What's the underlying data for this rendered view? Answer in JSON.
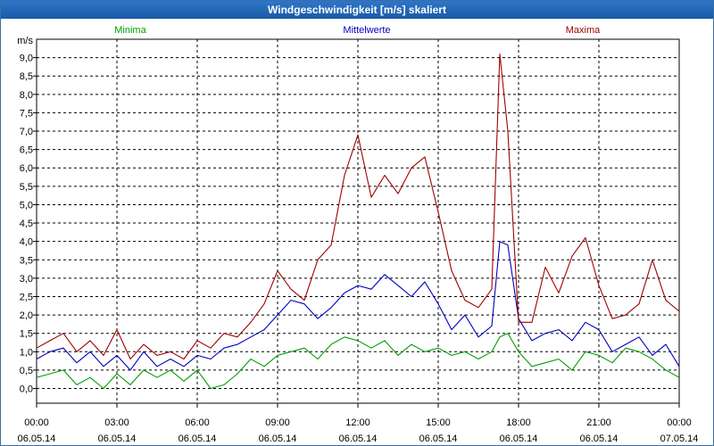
{
  "window": {
    "title": "Windgeschwindigkeit [m/s] skaliert"
  },
  "colors": {
    "minima": "#00a000",
    "mittelwerte": "#0000c0",
    "maxima": "#a00000"
  },
  "chart_data": {
    "type": "line",
    "title": "Windgeschwindigkeit [m/s] skaliert",
    "ylabel": "m/s",
    "xlabel": "",
    "ylim": [
      -0.4,
      9.5
    ],
    "xlim": [
      0,
      24
    ],
    "y_ticks": [
      "0,0",
      "0,5",
      "1,0",
      "1,5",
      "2,0",
      "2,5",
      "3,0",
      "3,5",
      "4,0",
      "4,5",
      "5,0",
      "5,5",
      "6,0",
      "6,5",
      "7,0",
      "7,5",
      "8,0",
      "8,5",
      "9,0"
    ],
    "x_ticks": [
      {
        "time": "00:00",
        "date": "06.05.14"
      },
      {
        "time": "03:00",
        "date": "06.05.14"
      },
      {
        "time": "06:00",
        "date": "06.05.14"
      },
      {
        "time": "09:00",
        "date": "06.05.14"
      },
      {
        "time": "12:00",
        "date": "06.05.14"
      },
      {
        "time": "15:00",
        "date": "06.05.14"
      },
      {
        "time": "18:00",
        "date": "06.05.14"
      },
      {
        "time": "21:00",
        "date": "06.05.14"
      },
      {
        "time": "00:00",
        "date": "07.05.14"
      }
    ],
    "grid": true,
    "legend_placement": "top",
    "series": [
      {
        "name": "Minima",
        "color": "#00a000",
        "x": [
          0,
          0.5,
          1,
          1.5,
          2,
          2.5,
          3,
          3.5,
          4,
          4.5,
          5,
          5.5,
          6,
          6.5,
          7,
          7.5,
          8,
          8.5,
          9,
          9.5,
          10,
          10.5,
          11,
          11.5,
          12,
          12.5,
          13,
          13.5,
          14,
          14.5,
          15,
          15.5,
          16,
          16.5,
          17,
          17.3,
          17.6,
          18,
          18.5,
          19,
          19.5,
          20,
          20.5,
          21,
          21.5,
          22,
          22.5,
          23,
          23.5,
          24
        ],
        "y": [
          0.3,
          0.4,
          0.5,
          0.1,
          0.3,
          0,
          0.4,
          0.1,
          0.5,
          0.3,
          0.5,
          0.2,
          0.5,
          0,
          0.1,
          0.4,
          0.8,
          0.6,
          0.9,
          1,
          1.1,
          0.8,
          1.2,
          1.4,
          1.3,
          1.1,
          1.3,
          0.9,
          1.2,
          1,
          1.1,
          0.9,
          1,
          0.8,
          1,
          1.4,
          1.5,
          1,
          0.6,
          0.7,
          0.8,
          0.5,
          1,
          0.9,
          0.7,
          1.1,
          1,
          0.8,
          0.5,
          0.3
        ]
      },
      {
        "name": "Mittelwerte",
        "color": "#0000c0",
        "x": [
          0,
          0.5,
          1,
          1.5,
          2,
          2.5,
          3,
          3.5,
          4,
          4.5,
          5,
          5.5,
          6,
          6.5,
          7,
          7.5,
          8,
          8.5,
          9,
          9.5,
          10,
          10.5,
          11,
          11.5,
          12,
          12.5,
          13,
          13.5,
          14,
          14.5,
          15,
          15.5,
          16,
          16.5,
          17,
          17.3,
          17.6,
          18,
          18.5,
          19,
          19.5,
          20,
          20.5,
          21,
          21.5,
          22,
          22.5,
          23,
          23.5,
          24
        ],
        "y": [
          0.8,
          1,
          1.1,
          0.7,
          1,
          0.6,
          0.9,
          0.5,
          1,
          0.6,
          0.8,
          0.6,
          0.9,
          0.8,
          1.1,
          1.2,
          1.4,
          1.6,
          2,
          2.4,
          2.3,
          1.9,
          2.2,
          2.6,
          2.8,
          2.7,
          3.1,
          2.8,
          2.5,
          2.9,
          2.3,
          1.6,
          2,
          1.4,
          1.7,
          4,
          3.9,
          1.9,
          1.3,
          1.5,
          1.6,
          1.3,
          1.8,
          1.6,
          1,
          1.2,
          1.4,
          0.9,
          1.2,
          0.6
        ]
      },
      {
        "name": "Maxima",
        "color": "#a00000",
        "x": [
          0,
          0.5,
          1,
          1.5,
          2,
          2.5,
          3,
          3.5,
          4,
          4.5,
          5,
          5.5,
          6,
          6.5,
          7,
          7.5,
          8,
          8.5,
          9,
          9.5,
          10,
          10.5,
          11,
          11.5,
          12,
          12.5,
          13,
          13.5,
          14,
          14.5,
          15,
          15.5,
          16,
          16.5,
          17,
          17.3,
          17.6,
          18,
          18.5,
          19,
          19.5,
          20,
          20.5,
          21,
          21.5,
          22,
          22.5,
          23,
          23.5,
          24
        ],
        "y": [
          1.1,
          1.3,
          1.5,
          1,
          1.3,
          0.9,
          1.6,
          0.8,
          1.2,
          0.9,
          1,
          0.8,
          1.3,
          1.1,
          1.5,
          1.4,
          1.8,
          2.3,
          3.2,
          2.7,
          2.4,
          3.5,
          3.9,
          5.8,
          6.9,
          5.2,
          5.8,
          5.3,
          6,
          6.3,
          4.8,
          3.2,
          2.4,
          2.2,
          2.7,
          9.1,
          7,
          1.8,
          1.8,
          3.3,
          2.6,
          3.6,
          4.1,
          2.8,
          1.9,
          2,
          2.3,
          3.5,
          2.4,
          2.1
        ]
      }
    ]
  }
}
